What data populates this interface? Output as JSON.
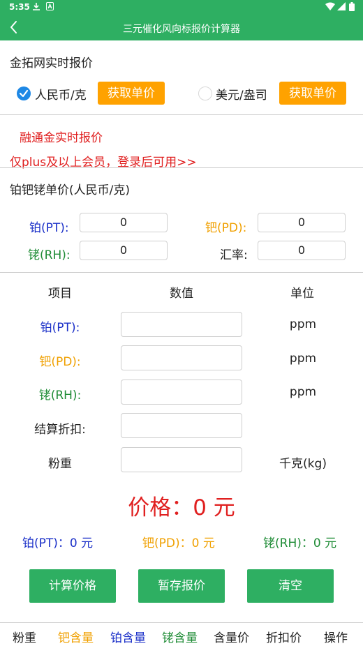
{
  "status": {
    "time": "5:35",
    "icons": [
      "download-icon",
      "a-badge-icon",
      "wifi-icon",
      "signal-icon",
      "battery-icon"
    ]
  },
  "appbar": {
    "title": "三元催化风向标报价计算器",
    "back_icon": "back-arrow-icon"
  },
  "jintuo": {
    "title": "金拓网实时报价",
    "rmb_label": "人民币/克",
    "usd_label": "美元/盎司",
    "fetch_label_1": "获取单价",
    "fetch_label_2": "获取单价",
    "selected": "rmb"
  },
  "rongtong": {
    "title": "融通金实时报价",
    "notice": "仅plus及以上会员，登录后可用>>"
  },
  "unit_price": {
    "title": "铂钯铑单价(人民币/克)",
    "pt_label": "铂(PT):",
    "pd_label": "钯(PD):",
    "rh_label": "铑(RH):",
    "rate_label": "汇率:",
    "pt_value": "0",
    "pd_value": "0",
    "rh_value": "0",
    "rate_value": "0"
  },
  "calc": {
    "headers": {
      "item": "项目",
      "value": "数值",
      "unit": "单位"
    },
    "rows": [
      {
        "label": "铂(PT):",
        "unit": "ppm",
        "value": ""
      },
      {
        "label": "钯(PD):",
        "unit": "ppm",
        "value": ""
      },
      {
        "label": "铑(RH):",
        "unit": "ppm",
        "value": ""
      },
      {
        "label": "结算折扣:",
        "unit": "",
        "value": ""
      },
      {
        "label": "粉重",
        "unit": "千克(kg)",
        "value": ""
      }
    ]
  },
  "result": {
    "price": "价格：0 元",
    "pt": "铂(PT)：0 元",
    "pd": "钯(PD)：0 元",
    "rh": "铑(RH)：0 元"
  },
  "actions": {
    "calculate": "计算价格",
    "save": "暂存报价",
    "clear": "清空"
  },
  "tabs": [
    "粉重",
    "钯含量",
    "铂含量",
    "铑含量",
    "含量价",
    "折扣价",
    "操作"
  ],
  "colors": {
    "primary_green": "#2eaf62",
    "orange": "#ffa200",
    "red": "#e02020",
    "blue": "#1a2fc8",
    "dark_green": "#1f8c36",
    "checked_blue": "#1e88e5"
  }
}
